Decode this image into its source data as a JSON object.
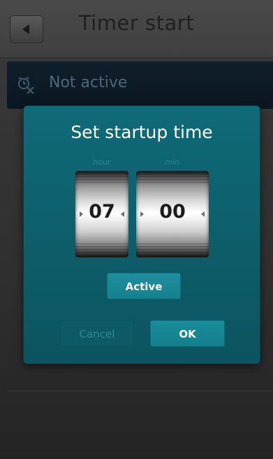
{
  "header": {
    "title": "Timer start"
  },
  "status": {
    "text": "Not active"
  },
  "dialog": {
    "title": "Set startup time",
    "hour_label": "hour",
    "minute_label": "min",
    "hour_value": "07",
    "minute_value": "00",
    "active_label": "Active",
    "cancel_label": "Cancel",
    "ok_label": "OK"
  },
  "colors": {
    "dialog_bg": "#0f6a77",
    "status_bg": "#0f1f2b",
    "accent": "#1a8d9b"
  }
}
